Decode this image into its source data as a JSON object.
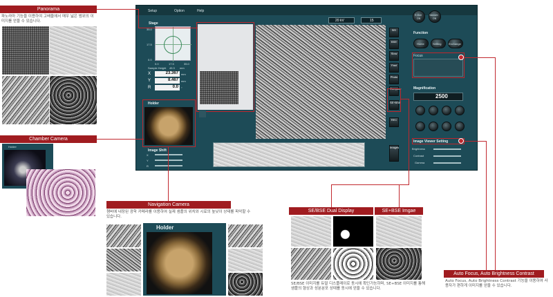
{
  "menu": {
    "setup": "Setup",
    "option": "Option",
    "help": "Help"
  },
  "top_controls": {
    "kv_value": "20 kV",
    "spot_value": "15"
  },
  "top_buttons": {
    "egun": "E-Gun",
    "egun_state": "ON",
    "vacuum": "Vacuum",
    "vacuum_state": "ON"
  },
  "stage": {
    "title": "Stage",
    "y_ticks": [
      "35.0",
      "17.5",
      "0.0"
    ],
    "x_ticks": [
      "0.0",
      "17.5",
      "35.0"
    ],
    "sample_height_label": "Sample Height",
    "sample_height_value": "45.3",
    "sample_height_unit": "mm",
    "x_label": "X",
    "x_value": "23.367",
    "x_unit": "mm",
    "y_label": "Y",
    "y_value": "8.467",
    "y_unit": "mm",
    "r_label": "R",
    "r_value": "0.0",
    "r_unit": "°"
  },
  "holder": {
    "title": "Holder"
  },
  "image_shift": {
    "title": "Image Shift",
    "x_label": "X",
    "y_label": "Y",
    "r_label": "R"
  },
  "function": {
    "title": "Function",
    "buttons": [
      "Home",
      "Setting",
      "Exchange"
    ],
    "focus_label": "Focus"
  },
  "magnification": {
    "title": "Magnification",
    "value": "2500"
  },
  "image_viewer": {
    "title": "Image Viewer Setting",
    "brightness": "Brightness",
    "contrast": "Contrast",
    "gamma": "Gamma"
  },
  "side_tools": [
    "SEI",
    "BSE",
    "Slow",
    "Fast",
    "Photo",
    "Compare",
    "SE+BSE",
    "REC",
    "Images"
  ],
  "callouts": {
    "panorama": {
      "title": "Panorama",
      "desc": "파노라마 기능을 이용하여 고배율에서 매우 넓은 범위의 이미지를 얻을 수 있습니다."
    },
    "chamber": {
      "title": "Chamber Camera",
      "holder_title": "Holder"
    },
    "navigation": {
      "title": "Navigation Camera",
      "desc": "챔버에 내장된 광학 카메라를 이용하여 실제 샘플의 위치와 시료의 높낮이 상태를 파악할 수 있습니다.",
      "holder_title": "Holder"
    },
    "dual_display": {
      "title": "SE/BSE Dual Display"
    },
    "se_bse": {
      "title": "SE+BSE Imgae"
    },
    "se_desc": "SE/BSE 이미지를 듀얼 디스플레이로 동시에 확인가능하며, SE+BSE 이미지를 통해 샘플의 형상과 성분분포 상태를 동시에 얻을 수 있습니다.",
    "autofocus": {
      "title": "Auto Focus, Auto Brightness Contrast",
      "desc": "Auto Focus, Auto Brightness Contrast 기능을 이용하여 사용자가 편하게 이미지를 얻을 수 있습니다."
    }
  },
  "colors": {
    "accent": "#c1272d",
    "window_bg": "#1d4b57",
    "callout_bg": "#a01c20"
  }
}
